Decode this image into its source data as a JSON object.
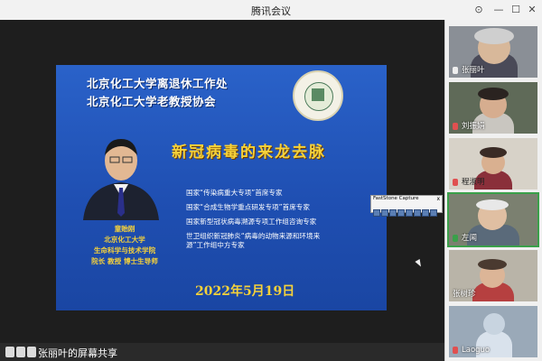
{
  "window": {
    "title": "腾讯会议"
  },
  "slide": {
    "header_line1": "北京化工大学离退休工作处",
    "header_line2": "北京化工大学老教授协会",
    "topic": "新冠病毒的来龙去脉",
    "credentials": [
      "国家“传染病重大专项”首席专家",
      "国家“合成生物学重点研发专项”首席专家",
      "国家新型冠状病毒溯源专项工作组咨询专家",
      "世卫组织新冠肺炎“病毒的动物来源和环境来",
      "源”工作组中方专家"
    ],
    "speaker_lines": [
      "童贻刚",
      "北京化工大学",
      "生命科学与技术学院",
      "院长 教授 博士生导师"
    ],
    "date": "2022年5月19日"
  },
  "capture_toolbar": {
    "title": "FastStone Capture",
    "close": "x"
  },
  "share": {
    "label": "张丽叶的屏幕共享"
  },
  "participants": [
    {
      "name": "张丽叶",
      "mic": "on"
    },
    {
      "name": "刘振娟",
      "mic": "muted"
    },
    {
      "name": "程淑明",
      "mic": "muted"
    },
    {
      "name": "左闻",
      "mic": "on"
    },
    {
      "name": "张树珍",
      "mic": "none"
    },
    {
      "name": "Laoguo",
      "mic": "muted"
    }
  ],
  "colors": {
    "slide_bg": "#1f4fb2",
    "accent_yellow": "#f6d23a",
    "active_speaker": "#3aa04a"
  }
}
